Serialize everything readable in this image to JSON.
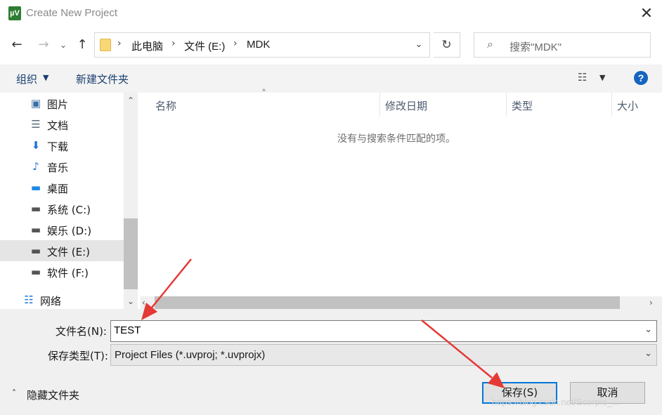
{
  "window": {
    "title": "Create New Project",
    "app_icon_text": "µV",
    "close_glyph": "✕"
  },
  "nav": {
    "back_glyph": "←",
    "forward_glyph": "→",
    "recent_glyph": "⌄",
    "up_glyph": "↑",
    "refresh_glyph": "↻",
    "breadcrumb": [
      "此电脑",
      "文件 (E:)",
      "MDK"
    ],
    "separator": "›",
    "address_dropdown_glyph": "⌄",
    "search_placeholder": "搜索\"MDK\"",
    "search_icon": "⌕"
  },
  "toolbar": {
    "organize": "组织",
    "new_folder": "新建文件夹",
    "view_icon": "☷",
    "help": "?"
  },
  "sidebar": {
    "items": [
      {
        "icon": "pictures-icon",
        "glyph": "▣",
        "color": "#3a6ea5",
        "label": "图片"
      },
      {
        "icon": "documents-icon",
        "glyph": "☰",
        "color": "#5a6b7d",
        "label": "文档"
      },
      {
        "icon": "downloads-icon",
        "glyph": "⬇",
        "color": "#1e73d8",
        "label": "下载"
      },
      {
        "icon": "music-icon",
        "glyph": "♪",
        "color": "#1e73d8",
        "label": "音乐"
      },
      {
        "icon": "desktop-icon",
        "glyph": "▬",
        "color": "#1e88e5",
        "label": "桌面"
      },
      {
        "icon": "system-drive-icon",
        "glyph": "▬",
        "color": "#555555",
        "label": "系统 (C:)"
      },
      {
        "icon": "drive-icon",
        "glyph": "▬",
        "color": "#555555",
        "label": "娱乐 (D:)"
      },
      {
        "icon": "drive-icon",
        "glyph": "▬",
        "color": "#555555",
        "label": "文件 (E:)",
        "selected": true
      },
      {
        "icon": "drive-icon",
        "glyph": "▬",
        "color": "#555555",
        "label": "软件 (F:)"
      }
    ],
    "network": {
      "icon": "network-icon",
      "glyph": "☷",
      "color": "#1e73d8",
      "label": "网络"
    }
  },
  "filelist": {
    "columns": [
      "名称",
      "修改日期",
      "类型",
      "大小"
    ],
    "empty_message": "没有与搜索条件匹配的项。",
    "sort_glyph": "˄"
  },
  "form": {
    "filename_label": "文件名(N):",
    "filename_value": "TEST",
    "filetype_label": "保存类型(T):",
    "filetype_value": "Project Files (*.uvproj; *.uvprojx)",
    "dropdown_glyph": "⌄"
  },
  "footer": {
    "hide_folders": "隐藏文件夹",
    "hide_caret": "˄",
    "save_button": "保存(S)",
    "cancel_button": "取消"
  },
  "watermark": "https://blog.csdn.net/Scorpio_...",
  "colors": {
    "accent": "#0078d7",
    "annotation": "#e53935"
  }
}
